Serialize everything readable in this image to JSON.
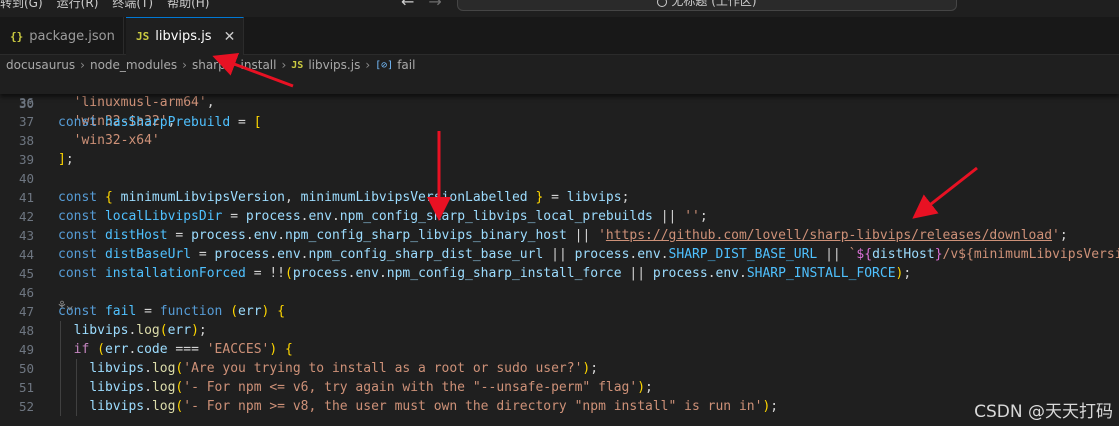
{
  "menu": [
    "转到(G)",
    "运行(R)",
    "终端(T)",
    "帮助(H)"
  ],
  "nav": {
    "back": "←",
    "forward": "→"
  },
  "command_center": {
    "label": "无标题 (工作区)"
  },
  "tabs": [
    {
      "icon": "{}",
      "label": "package.json",
      "close": "✕",
      "active": false
    },
    {
      "icon": "JS",
      "label": "libvips.js",
      "close": "✕",
      "active": true
    }
  ],
  "breadcrumb": [
    "docusaurus",
    "node_modules",
    "sharp",
    "install",
    "libvips.js",
    "fail"
  ],
  "breadcrumb_icons": {
    "js": "JS",
    "fn": "[⊘]"
  },
  "sticky": {
    "ln": "30",
    "parts": [
      "const ",
      "hasSharpPrebuild",
      " = ",
      "["
    ]
  },
  "lines": [
    {
      "ln": "36",
      "text": "  'linuxmusl-arm64',"
    },
    {
      "ln": "37",
      "text": "  'win32-ia32',"
    },
    {
      "ln": "38",
      "text": "  'win32-x64'"
    },
    {
      "ln": "39",
      "text": "];"
    },
    {
      "ln": "40",
      "text": ""
    },
    {
      "ln": "41",
      "text": "const { minimumLibvipsVersion, minimumLibvipsVersionLabelled } = libvips;"
    },
    {
      "ln": "42",
      "text": "const localLibvipsDir = process.env.npm_config_sharp_libvips_local_prebuilds || '';"
    },
    {
      "ln": "43",
      "text": "const distHost = process.env.npm_config_sharp_libvips_binary_host || 'https://github.com/lovell/sharp-libvips/releases/download';"
    },
    {
      "ln": "44",
      "text": "const distBaseUrl = process.env.npm_config_sharp_dist_base_url || process.env.SHARP_DIST_BASE_URL || `${distHost}/v${minimumLibvipsVersion"
    },
    {
      "ln": "45",
      "text": "const installationForced = !!(process.env.npm_config_sharp_install_force || process.env.SHARP_INSTALL_FORCE);"
    },
    {
      "ln": "46",
      "text": ""
    },
    {
      "ln": "47",
      "text": "const fail = function (err) {"
    },
    {
      "ln": "48",
      "text": "  libvips.log(err);"
    },
    {
      "ln": "49",
      "text": "  if (err.code === 'EACCES') {"
    },
    {
      "ln": "50",
      "text": "    libvips.log('Are you trying to install as a root or sudo user?');"
    },
    {
      "ln": "51",
      "text": "    libvips.log('- For npm <= v6, try again with the \"--unsafe-perm\" flag');"
    },
    {
      "ln": "52",
      "text": "    libvips.log('- For npm >= v8, the user must own the directory \"npm install\" is run in');"
    }
  ],
  "fold_hint": "⚘⌄",
  "watermark": "CSDN @天天打码",
  "colors": {
    "arrow": "#e81123",
    "accent": "#0078d4"
  }
}
